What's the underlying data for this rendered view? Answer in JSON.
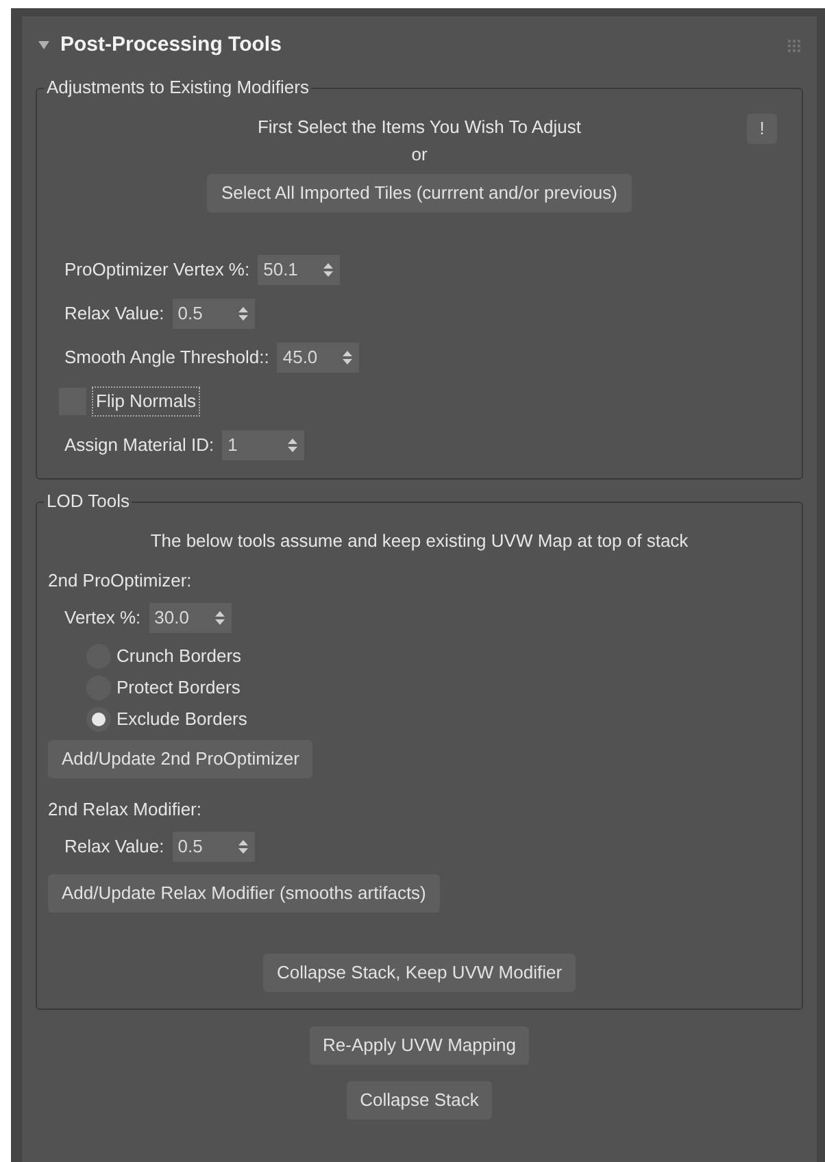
{
  "rollout": {
    "title": "Post-Processing Tools",
    "expanded": true
  },
  "groups": [
    {
      "title": "Adjustments to Existing Modifiers",
      "items": [
        {
          "kind": "note",
          "text": "First Select the Items You Wish To Adjust",
          "info": "!"
        },
        {
          "kind": "note",
          "text": "or"
        },
        {
          "kind": "wide-button",
          "label": "Select All Imported Tiles (currrent and/or previous)"
        },
        {
          "kind": "gap"
        },
        {
          "kind": "spinner",
          "label": "ProOptimizer Vertex %:",
          "value": "50.1"
        },
        {
          "kind": "spinner",
          "label": "Relax Value:",
          "value": "0.5"
        },
        {
          "kind": "spinner",
          "label": "Smooth Angle Threshold::",
          "value": "45.0"
        },
        {
          "kind": "checkbox",
          "label": "Flip Normals",
          "checked": false
        },
        {
          "kind": "spinner",
          "label": "Assign Material ID:",
          "value": "1"
        }
      ]
    },
    {
      "title": "LOD Tools",
      "items": [
        {
          "kind": "note",
          "text": "The below tools assume and keep existing UVW Map at top of stack"
        },
        {
          "kind": "heading",
          "text": "2nd ProOptimizer:"
        },
        {
          "kind": "spinner",
          "label": "Vertex %:",
          "value": "30.0"
        },
        {
          "kind": "radio",
          "label": "Crunch Borders",
          "selected": false
        },
        {
          "kind": "radio",
          "label": "Protect Borders",
          "selected": false
        },
        {
          "kind": "radio",
          "label": "Exclude Borders",
          "selected": true
        },
        {
          "kind": "button",
          "label": "Add/Update 2nd ProOptimizer"
        },
        {
          "kind": "heading",
          "text": "2nd Relax Modifier:"
        },
        {
          "kind": "spinner",
          "label": "Relax Value:",
          "value": "0.5"
        },
        {
          "kind": "button",
          "label": "Add/Update Relax Modifier (smooths artifacts)"
        },
        {
          "kind": "gap"
        },
        {
          "kind": "wide-button",
          "label": "Collapse Stack, Keep UVW Modifier"
        }
      ]
    }
  ],
  "buttons": [
    "Re-Apply UVW Mapping",
    "Collapse Stack"
  ]
}
